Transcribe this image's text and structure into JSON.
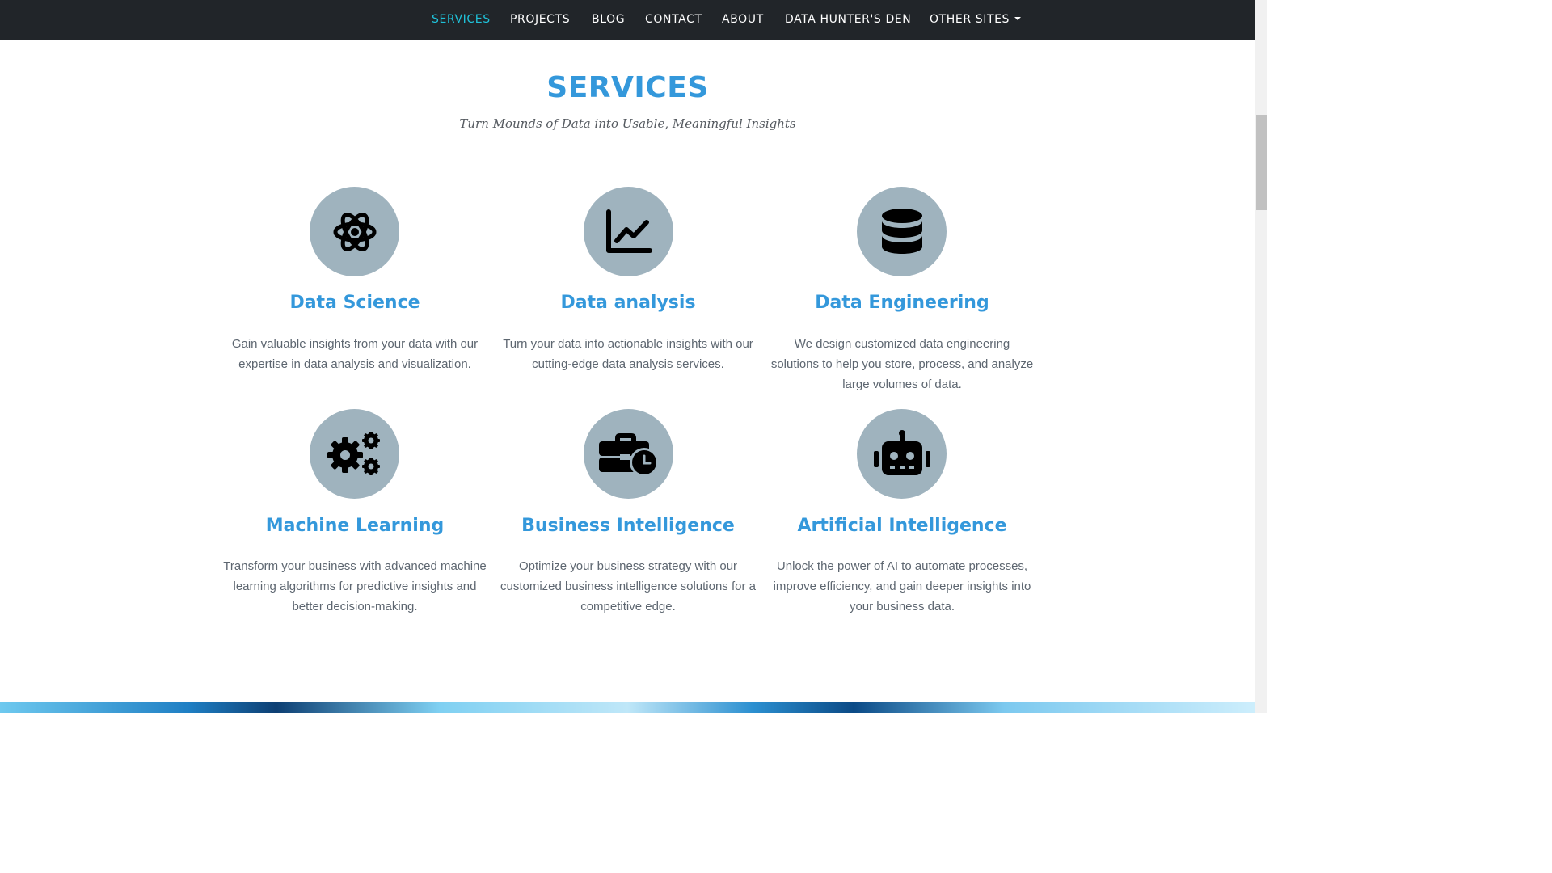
{
  "nav": {
    "items": [
      "SERVICES",
      "PROJECTS",
      "BLOG",
      "CONTACT",
      "ABOUT",
      "DATA HUNTER'S DEN"
    ],
    "dropdown_label": "OTHER SITES",
    "active": "SERVICES"
  },
  "section": {
    "title": "SERVICES",
    "subtitle": "Turn Mounds of Data into Usable, Meaningful Insights"
  },
  "services": [
    {
      "icon": "atom-icon",
      "title": "Data Science",
      "lines": [
        "Gain valuable insights from your data with our",
        "expertise in data analysis and visualization."
      ]
    },
    {
      "icon": "chart-line-icon",
      "title": "Data analysis",
      "lines": [
        "Turn your data into actionable insights with our",
        "cutting-edge data analysis services."
      ]
    },
    {
      "icon": "database-icon",
      "title": "Data Engineering",
      "lines": [
        "We design customized data engineering",
        "solutions to help you store, process, and analyze",
        "large volumes of data."
      ]
    },
    {
      "icon": "gears-icon",
      "title": "Machine Learning",
      "lines": [
        "Transform your business with advanced machine",
        "learning algorithms for predictive insights and",
        "better decision-making."
      ]
    },
    {
      "icon": "business-time-icon",
      "title": "Business Intelligence",
      "lines": [
        "Optimize your business strategy with our",
        "customized business intelligence solutions for a",
        "competitive edge."
      ]
    },
    {
      "icon": "robot-icon",
      "title": "Artificial Intelligence",
      "lines": [
        "Unlock the power of AI to automate processes,",
        "improve efficiency, and gain deeper insights into",
        "your business data."
      ]
    }
  ],
  "colors": {
    "navbar_bg": "#212529",
    "nav_active": "#1fc1d8",
    "accent": "#3498db",
    "icon_circle": "#9fb3be",
    "body_text": "#5d6670"
  }
}
